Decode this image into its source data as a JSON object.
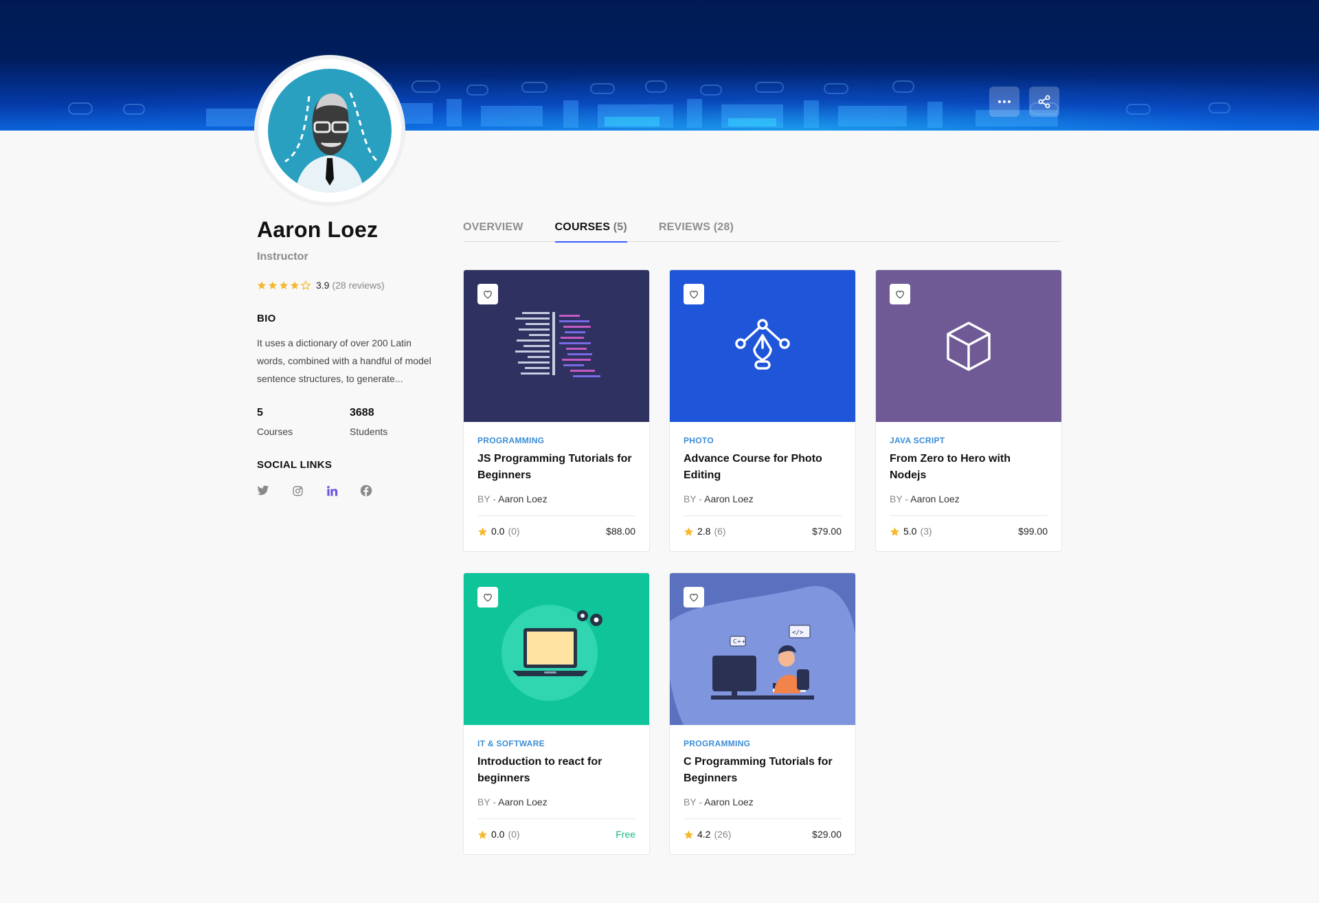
{
  "colors": {
    "accent": "#3b5bff",
    "category": "#3c8dd6",
    "star": "#f5b82e",
    "free": "#1fb589"
  },
  "banner": {
    "more_icon": "more-horizontal-icon",
    "share_icon": "share-icon"
  },
  "profile": {
    "name": "Aaron Loez",
    "role": "Instructor",
    "rating": "3.9",
    "rating_value": 3.9,
    "reviews_label": "(28 reviews)",
    "bio_heading": "BIO",
    "bio": "It uses a dictionary of over 200 Latin words, combined with a handful of model sentence structures, to generate...",
    "stats": [
      {
        "value": "5",
        "label": "Courses"
      },
      {
        "value": "3688",
        "label": "Students"
      }
    ],
    "social_heading": "SOCIAL LINKS",
    "social": [
      "twitter-icon",
      "instagram-icon",
      "linkedin-icon",
      "facebook-icon"
    ]
  },
  "tabs": [
    {
      "label": "OVERVIEW",
      "count": ""
    },
    {
      "label": "COURSES",
      "count": "(5)"
    },
    {
      "label": "REVIEWS",
      "count": "(28)"
    }
  ],
  "courses": [
    {
      "category": "PROGRAMMING",
      "title": "JS Programming Tutorials for Beginners",
      "by": "BY -",
      "author": "Aaron Loez",
      "rating": "0.0",
      "count": "(0)",
      "price": "$88.00",
      "thumb_color": "#2f3160"
    },
    {
      "category": "PHOTO",
      "title": "Advance Course for Photo Editing",
      "by": "BY -",
      "author": "Aaron Loez",
      "rating": "2.8",
      "count": "(6)",
      "price": "$79.00",
      "thumb_color": "#1f55d8"
    },
    {
      "category": "JAVA SCRIPT",
      "title": "From Zero to Hero with Nodejs",
      "by": "BY -",
      "author": "Aaron Loez",
      "rating": "5.0",
      "count": "(3)",
      "price": "$99.00",
      "thumb_color": "#6f5a96"
    },
    {
      "category": "IT & SOFTWARE",
      "title": "Introduction to react for beginners",
      "by": "BY -",
      "author": "Aaron Loez",
      "rating": "0.0",
      "count": "(0)",
      "price": "Free",
      "thumb_color": "#10c49a"
    },
    {
      "category": "PROGRAMMING",
      "title": "C Programming Tutorials for Beginners",
      "by": "BY -",
      "author": "Aaron Loez",
      "rating": "4.2",
      "count": "(26)",
      "price": "$29.00",
      "thumb_color": "#5a71c0"
    }
  ]
}
